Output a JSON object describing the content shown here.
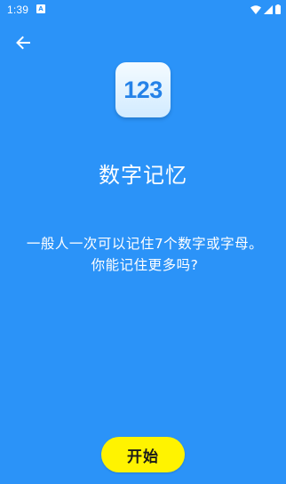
{
  "status_bar": {
    "time": "1:39",
    "notification_icon_glyph": "A",
    "icons": [
      "wifi-icon",
      "signal-icon",
      "battery-icon"
    ]
  },
  "nav": {
    "back_icon": "arrow-left-icon"
  },
  "app_icon": {
    "label": "123"
  },
  "main": {
    "title": "数字记忆",
    "description": "一般人一次可以记住7个数字或字母。你能记住更多吗?"
  },
  "actions": {
    "start_label": "开始"
  },
  "colors": {
    "background": "#2b93f8",
    "button": "#fff300",
    "icon_text": "#2582e8"
  }
}
